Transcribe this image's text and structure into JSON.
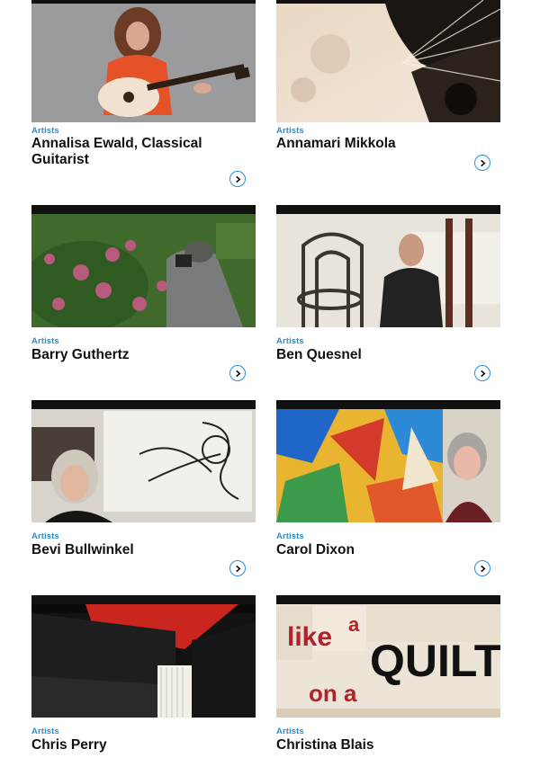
{
  "cards": [
    {
      "category": "Artists",
      "name": "Annalisa Ewald, Classical Guitarist",
      "image_alt": "woman playing classical guitar"
    },
    {
      "category": "Artists",
      "name": "Annamari Mikkola",
      "image_alt": "sepia abstract photo"
    },
    {
      "category": "Artists",
      "name": "Barry Guthertz",
      "image_alt": "photographer among pink flowers"
    },
    {
      "category": "Artists",
      "name": "Ben Quesnel",
      "image_alt": "man seated behind bentwood chairs"
    },
    {
      "category": "Artists",
      "name": "Bevi Bullwinkel",
      "image_alt": "woman in front of abstract drawing"
    },
    {
      "category": "Artists",
      "name": "Carol Dixon",
      "image_alt": "woman beside colorful painting"
    },
    {
      "category": "Artists",
      "name": "Chris Perry",
      "image_alt": "bound book edge in red and black"
    },
    {
      "category": "Artists",
      "name": "Christina Blais",
      "image_alt": "quilt with letters"
    }
  ],
  "quilt_text": {
    "line1a": "like",
    "line1b": "a",
    "line1c": "QUILT",
    "line2": "on a"
  },
  "colors": {
    "accent": "#2a8fd4",
    "text": "#111111",
    "background": "#ffffff"
  }
}
